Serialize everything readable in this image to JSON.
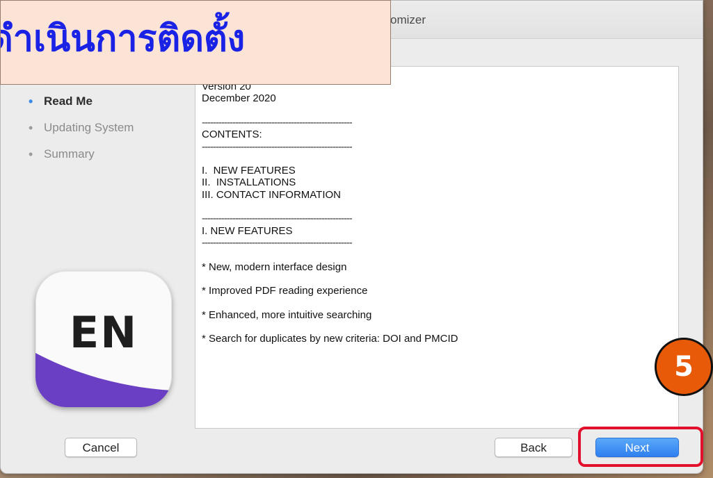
{
  "window": {
    "title_fragment": "omizer"
  },
  "banner": {
    "text": "ดำเนินการติดตั้ง"
  },
  "sidebar": {
    "steps": [
      {
        "label": "Read Me",
        "active": true
      },
      {
        "label": "Updating System",
        "active": false
      },
      {
        "label": "Summary",
        "active": false
      }
    ]
  },
  "app_icon": {
    "letters": "EN",
    "icon": "endnote-app-icon",
    "accent_color": "#6a3fc4"
  },
  "readme": {
    "lines": [
      "Version 20",
      "December 2020",
      "",
      "------------------------------------------------------",
      "CONTENTS:",
      "------------------------------------------------------",
      "",
      "I.  NEW FEATURES",
      "II.  INSTALLATIONS",
      "III. CONTACT INFORMATION",
      "",
      "------------------------------------------------------",
      "I. NEW FEATURES",
      "------------------------------------------------------",
      "",
      "* New, modern interface design",
      "",
      "* Improved PDF reading experience",
      "",
      "* Enhanced, more intuitive searching",
      "",
      "* Search for duplicates by new criteria: DOI and PMCID"
    ]
  },
  "buttons": {
    "cancel": "Cancel",
    "back": "Back",
    "next": "Next"
  },
  "annotation": {
    "step_number": "5",
    "badge_color": "#e85a08",
    "highlight_color": "#e3102b"
  }
}
